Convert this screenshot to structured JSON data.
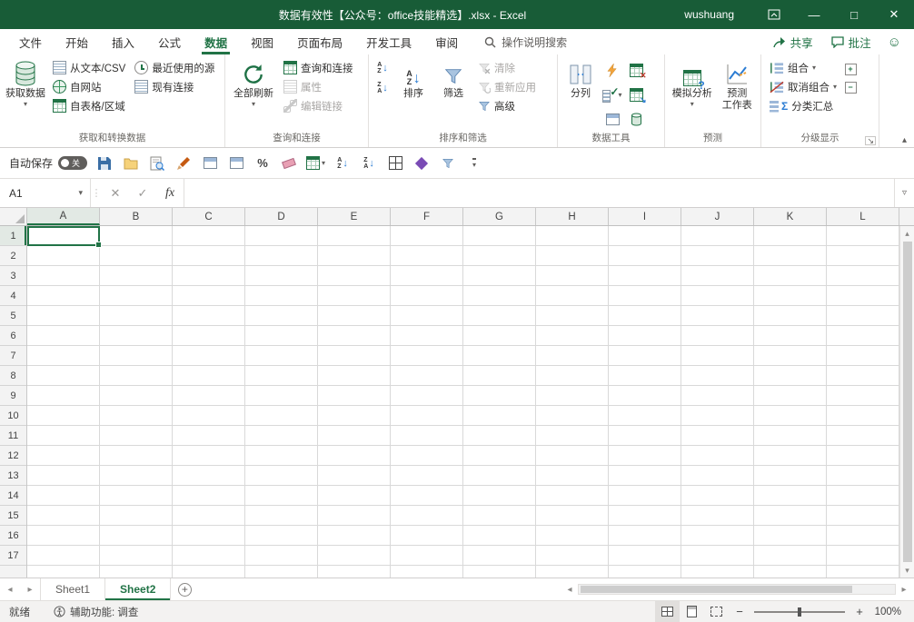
{
  "colors": {
    "titlebar": "#185c37",
    "accent": "#217346"
  },
  "titlebar": {
    "title": "数据有效性【公众号：office技能精选】.xlsx - Excel",
    "user": "wushuang"
  },
  "tab_row": {
    "tabs": [
      {
        "label": "文件"
      },
      {
        "label": "开始"
      },
      {
        "label": "插入"
      },
      {
        "label": "公式"
      },
      {
        "label": "数据",
        "active": true
      },
      {
        "label": "视图"
      },
      {
        "label": "页面布局"
      },
      {
        "label": "开发工具"
      },
      {
        "label": "审阅"
      }
    ],
    "search_label": "操作说明搜索",
    "share_label": "共享",
    "comments_label": "批注"
  },
  "ribbon": {
    "get_transform": {
      "group_label": "获取和转换数据",
      "get_data": "获取数据",
      "from_text": "从文本/CSV",
      "from_web": "自网站",
      "from_table": "自表格/区域",
      "recent_sources": "最近使用的源",
      "existing_connections": "现有连接"
    },
    "queries": {
      "group_label": "查询和连接",
      "refresh_all": "全部刷新",
      "queries_connections": "查询和连接",
      "properties": "属性",
      "edit_links": "编辑链接"
    },
    "sort_filter": {
      "group_label": "排序和筛选",
      "sort": "排序",
      "filter": "筛选",
      "clear": "清除",
      "reapply": "重新应用",
      "advanced": "高级"
    },
    "data_tools": {
      "group_label": "数据工具",
      "text_to_columns": "分列"
    },
    "forecast": {
      "group_label": "预测",
      "what_if": "模拟分析",
      "forecast_sheet": "预测\n工作表"
    },
    "outline": {
      "group_label": "分级显示",
      "group": "组合",
      "ungroup": "取消组合",
      "subtotal": "分类汇总"
    }
  },
  "qat": {
    "autosave_label": "自动保存",
    "autosave_state": "关"
  },
  "formula_bar": {
    "name_box": "A1",
    "fx": "fx",
    "formula": ""
  },
  "grid": {
    "columns": [
      "A",
      "B",
      "C",
      "D",
      "E",
      "F",
      "G",
      "H",
      "I",
      "J",
      "K",
      "L"
    ],
    "rows": 17,
    "selected": {
      "col": "A",
      "row": 1,
      "cell": "A1"
    }
  },
  "sheet_bar": {
    "sheets": [
      {
        "name": "Sheet1",
        "active": false
      },
      {
        "name": "Sheet2",
        "active": true
      }
    ]
  },
  "status_bar": {
    "ready": "就绪",
    "accessibility": "辅助功能: 调查",
    "zoom": "100%"
  },
  "icons": {
    "caret": "▾",
    "chevron_up": "▴",
    "chevron_down": "▿",
    "arrow_down": "↓",
    "close": "✕",
    "check": "✓",
    "letter_a": "A",
    "letter_z": "Z",
    "percent": "%",
    "sigma": "Σ",
    "smiley": "☺",
    "plus": "+",
    "minus": "−",
    "left": "◂",
    "right": "▸",
    "ellipsis_v": "⋮",
    "min_glyph": "—",
    "max_glyph": "□",
    "launcher": "↘",
    "question": "?"
  }
}
